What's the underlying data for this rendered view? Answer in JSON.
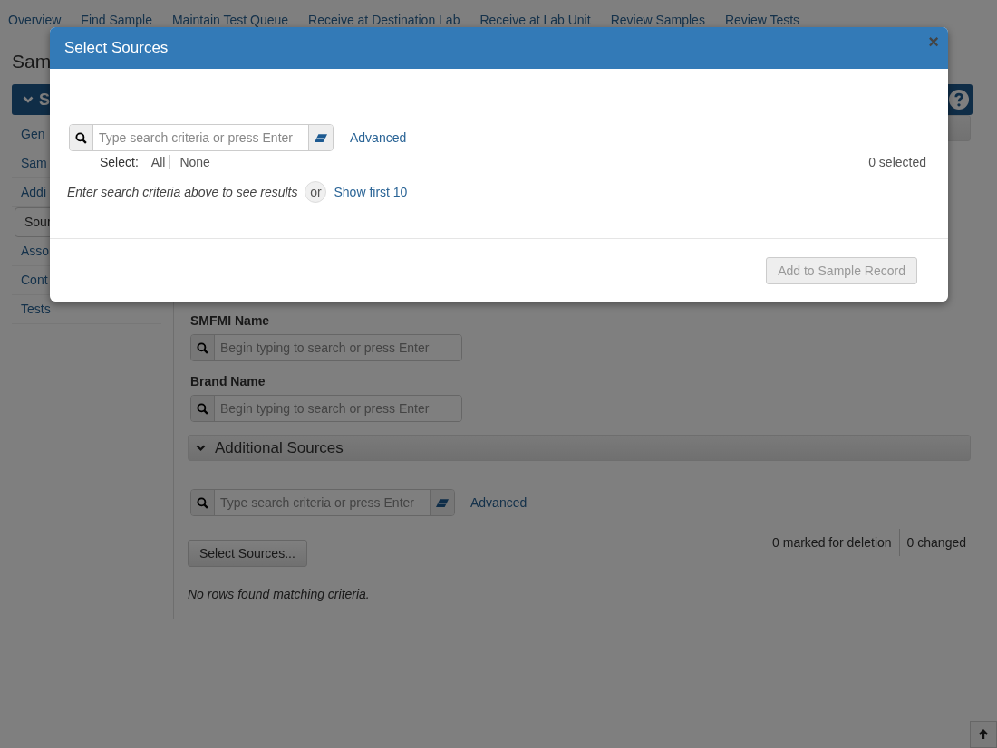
{
  "nav": [
    "Overview",
    "Find Sample",
    "Maintain Test Queue",
    "Receive at Destination Lab",
    "Receive at Lab Unit",
    "Review Samples",
    "Review Tests"
  ],
  "page_title": "Sam",
  "section_header": {
    "title": "S",
    "expanded": true
  },
  "sidebar": {
    "items": [
      {
        "label": "Gen",
        "selected": false
      },
      {
        "label": "Sam",
        "selected": false
      },
      {
        "label": "Addi",
        "selected": false
      },
      {
        "label": "Sour",
        "selected": true
      },
      {
        "label": "Asso",
        "selected": false
      },
      {
        "label": "Cont",
        "selected": false
      },
      {
        "label": "Tests",
        "selected": false
      }
    ]
  },
  "main": {
    "fields": [
      {
        "label": "SMFMI Name",
        "placeholder": "Begin typing to search or press Enter"
      },
      {
        "label": "Brand Name",
        "placeholder": "Begin typing to search or press Enter"
      }
    ],
    "additional_sources": {
      "title": "Additional Sources",
      "expanded": true,
      "search": {
        "placeholder": "Type search criteria or press Enter"
      },
      "advanced_link": "Advanced",
      "select_button": "Select Sources...",
      "marked_for_deletion": "0 marked for deletion",
      "changed": "0 changed",
      "empty_message": "No rows found matching criteria."
    }
  },
  "modal": {
    "title": "Select Sources",
    "close": "×",
    "search": {
      "placeholder": "Type search criteria or press Enter"
    },
    "advanced_link": "Advanced",
    "select_label": "Select:",
    "select_all": "All",
    "select_none": "None",
    "selected_count": "0 selected",
    "hint": "Enter search criteria above to see results",
    "or": "or",
    "show_first": "Show first 10",
    "add_button": {
      "label": "Add to Sample Record",
      "disabled": true
    }
  }
}
